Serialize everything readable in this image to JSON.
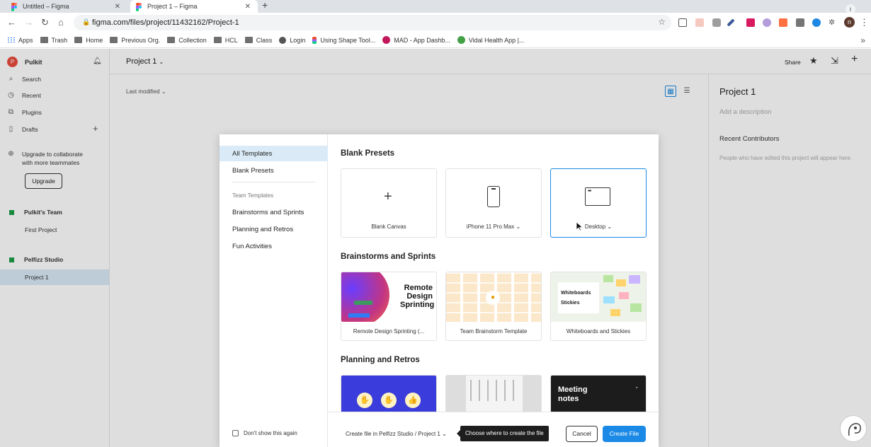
{
  "browser": {
    "tabs": [
      {
        "title": "Untitled – Figma"
      },
      {
        "title": "Project 1 – Figma"
      }
    ],
    "new_tab": "+",
    "url": "figma.com/files/project/11432162/Project-1",
    "profile_initial": "n",
    "bookmarks": [
      "Apps",
      "Trash",
      "Home",
      "Previous Org.",
      "Collection",
      "HCL",
      "Class",
      "Login",
      "Using Shape Tool...",
      "MAD - App Dashb...",
      "Vidal Health App |..."
    ]
  },
  "sidebar": {
    "user": "Pulkit",
    "user_initial": "P",
    "items": [
      "Search",
      "Recent",
      "Plugins",
      "Drafts"
    ],
    "upgrade_text_1": "Upgrade to collaborate",
    "upgrade_text_2": "with more teammates",
    "upgrade_button": "Upgrade",
    "teams": [
      {
        "name": "Pulkit's Team",
        "project": "First Project"
      },
      {
        "name": "Pelfizz Studio",
        "project": "Project 1"
      }
    ]
  },
  "header": {
    "project_title": "Project 1",
    "share": "Share"
  },
  "content": {
    "sort": "Last modified"
  },
  "right_panel": {
    "title": "Project 1",
    "description_placeholder": "Add a description",
    "contributors_title": "Recent Contributors",
    "contributors_note": "People who have edited this project will appear here."
  },
  "modal": {
    "nav": {
      "all_templates": "All Templates",
      "blank_presets": "Blank Presets",
      "team_templates": "Team Templates",
      "brainstorms": "Brainstorms and Sprints",
      "planning": "Planning and Retros",
      "fun": "Fun Activities"
    },
    "dont_show": "Don't show this again",
    "sections": {
      "blank": "Blank Presets",
      "brainstorms": "Brainstorms and Sprints",
      "planning": "Planning and Retros"
    },
    "blank_cards": [
      "Blank Canvas",
      "iPhone 11 Pro Max",
      "Desktop"
    ],
    "brainstorm_cards": [
      "Remote Design Sprinting (...",
      "Team Brainstorm Template",
      "Whiteboards and Stickies"
    ],
    "thumb_text": {
      "remote_1": "Remote",
      "remote_2": "Design",
      "remote_3": "Sprinting",
      "whiteboards": "Whiteboards",
      "stickies": "Stickies",
      "meeting_1": "Meeting",
      "meeting_2": "notes"
    },
    "footer": {
      "location": "Create file in Pelfizz Studio / Project 1",
      "tooltip": "Choose where to create the file",
      "cancel": "Cancel",
      "create": "Create File"
    }
  },
  "colors": {
    "accent": "#1b8ae6",
    "selected_bg": "#daebf7",
    "team": "#1e9e47"
  }
}
